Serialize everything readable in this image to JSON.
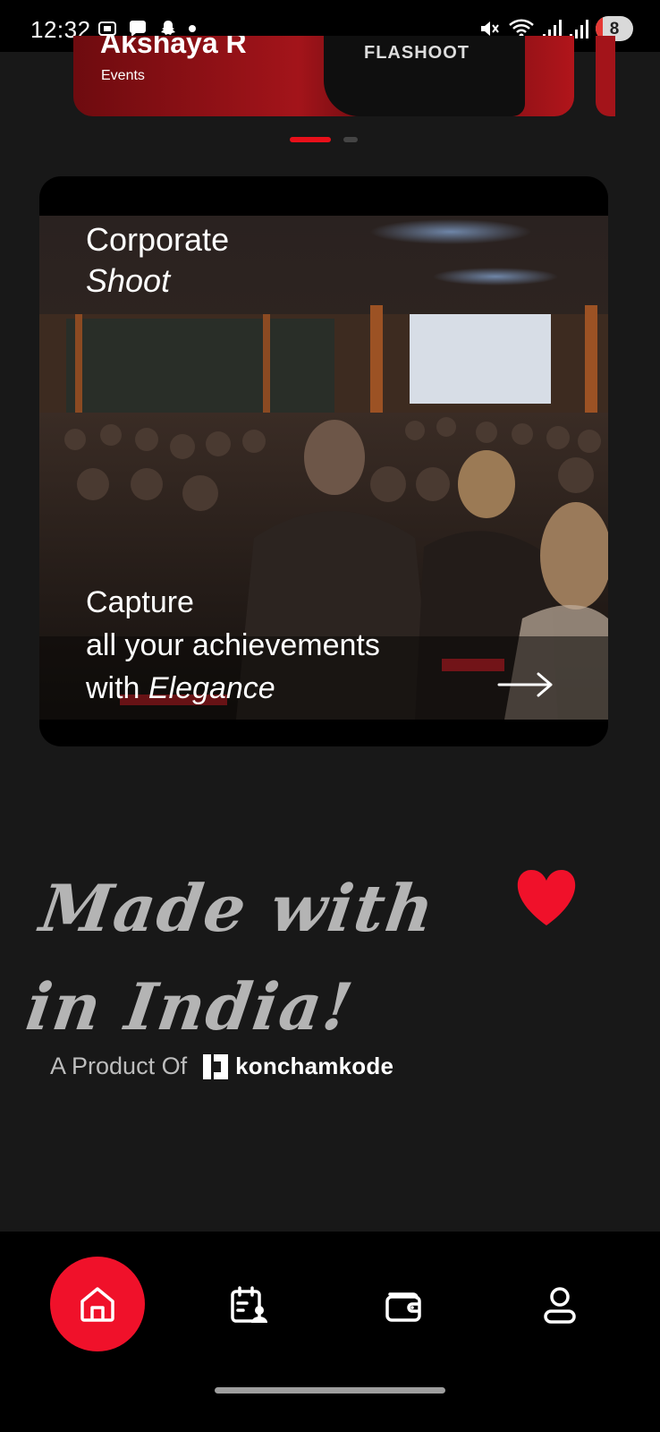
{
  "status_bar": {
    "time": "12:32",
    "battery": "8"
  },
  "carousel": {
    "card": {
      "name": "Akshaya R",
      "category": "Events",
      "shirt_text": "FLASHOOT"
    },
    "active_index": 0,
    "total": 2
  },
  "shoot_card": {
    "title_line1": "Corporate",
    "title_line2": "Shoot",
    "caption_line1": "Capture",
    "caption_line2": "all your achievements",
    "caption_line3_prefix": "with ",
    "caption_line3_italic": "Elegance"
  },
  "footer": {
    "made_line1": "Made with",
    "made_line2": "in India!",
    "product_label": "A Product Of",
    "brand_name": "konchamkode"
  },
  "nav": {
    "items": [
      "home",
      "bookings",
      "wallet",
      "profile"
    ],
    "active": "home"
  },
  "colors": {
    "accent": "#f0112a",
    "background": "#181818"
  }
}
